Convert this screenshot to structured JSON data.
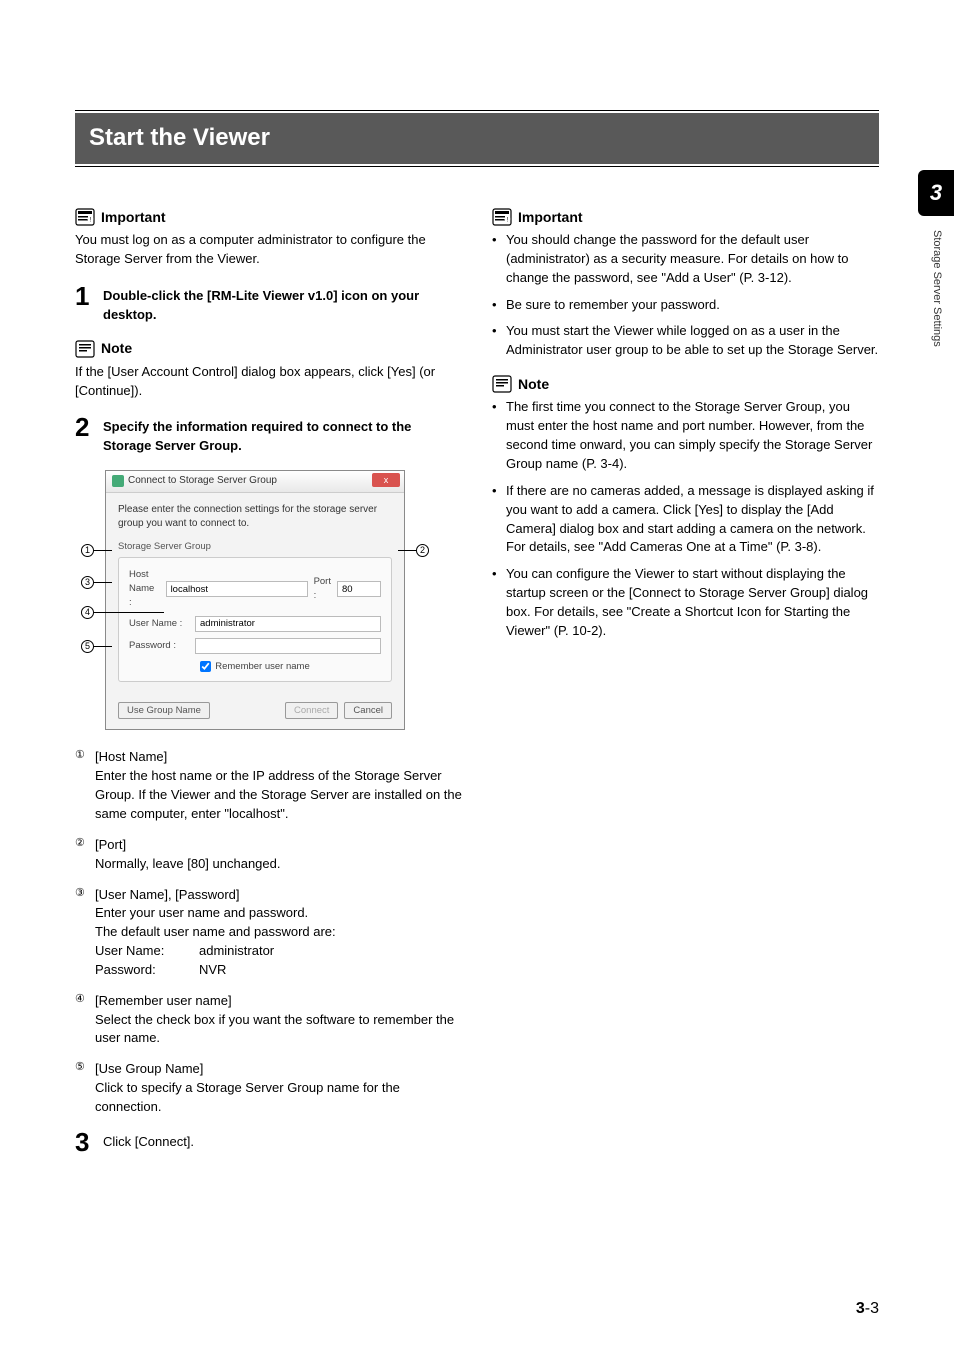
{
  "page": {
    "chapter_num": "3",
    "side_label": "Storage Server Settings",
    "footer_chapter": "3",
    "footer_page": "-3",
    "h1": "Start the Viewer"
  },
  "left": {
    "important_label": "Important",
    "important_text": "You must log on as a computer administrator to configure the Storage Server from the Viewer.",
    "step1_num": "1",
    "step1_text": "Double-click the [RM-Lite Viewer v1.0] icon on your desktop.",
    "note_label": "Note",
    "note_text": "If the [User Account Control] dialog box appears, click [Yes] (or [Continue]).",
    "step2_num": "2",
    "step2_text": "Specify the information required to connect to the Storage Server Group.",
    "enum": [
      {
        "mark": "①",
        "title": "[Host Name]",
        "body": "Enter the host name or the IP address of the Storage Server Group. If the Viewer and the Storage Server are installed on the same computer, enter \"localhost\"."
      },
      {
        "mark": "②",
        "title": "[Port]",
        "body": "Normally, leave [80] unchanged."
      },
      {
        "mark": "③",
        "title": "[User Name], [Password]",
        "body": "Enter your user name and password.\nThe default user name and password are:",
        "def": [
          {
            "label": "User Name:",
            "val": "administrator"
          },
          {
            "label": "Password:",
            "val": "NVR"
          }
        ]
      },
      {
        "mark": "④",
        "title": "[Remember user name]",
        "body": "Select the check box if you want the software to remember the user name."
      },
      {
        "mark": "⑤",
        "title": "[Use Group Name]",
        "body": "Click to specify a Storage Server Group name for the connection."
      }
    ],
    "step3_num": "3",
    "step3_text": "Click [Connect]."
  },
  "right": {
    "important_label": "Important",
    "important_bullets": [
      "You should change the password for the default user (administrator) as a security measure. For details on how to change the password, see \"Add a User\" (P. 3-12).",
      "Be sure to remember your password.",
      "You must start the Viewer while logged on as a user in the Administrator user group to be able to set up the Storage Server."
    ],
    "note_label": "Note",
    "note_bullets": [
      "The first time you connect to the Storage Server Group, you must enter the host name and port number. However, from the second time onward, you can simply specify the Storage Server Group name (P. 3-4).",
      "If there are no cameras added, a message is displayed asking if you want to add a camera. Click [Yes] to display the [Add Camera] dialog box and start adding a camera on the network. For details, see \"Add Cameras One at a Time\" (P. 3-8).",
      "You can configure the Viewer to start without displaying the startup screen or the [Connect to Storage Server Group] dialog box. For details, see \"Create a Shortcut Icon for Starting the Viewer\" (P. 10-2)."
    ]
  },
  "dialog": {
    "title": "Connect to Storage Server Group",
    "close": "x",
    "msg": "Please enter the connection settings for the storage server group you want to connect to.",
    "group_label": "Storage Server Group",
    "host_label": "Host Name :",
    "host_value": "localhost",
    "port_label": "Port :",
    "port_value": "80",
    "user_label": "User Name :",
    "user_value": "administrator",
    "pass_label": "Password :",
    "pass_value": "",
    "remember_label": "Remember user name",
    "use_group": "Use Group Name",
    "connect": "Connect",
    "cancel": "Cancel",
    "annot": {
      "a1": "1",
      "a2": "2",
      "a3": "3",
      "a4": "4",
      "a5": "5"
    }
  }
}
